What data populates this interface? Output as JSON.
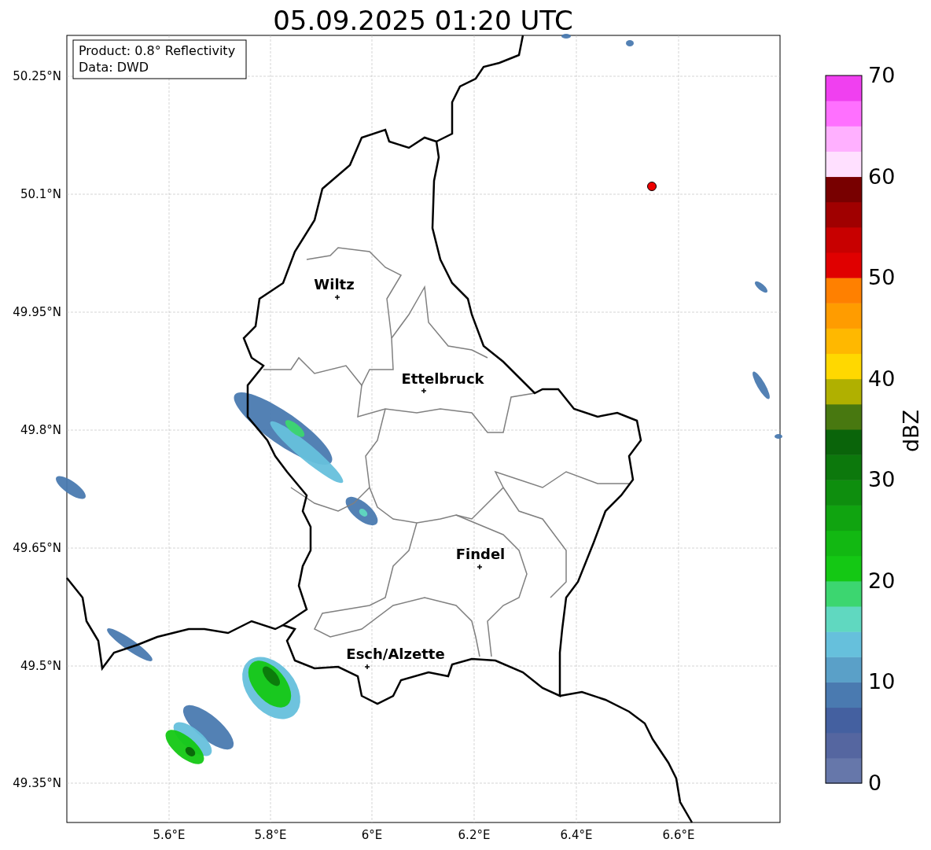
{
  "title": "05.09.2025 01:20 UTC",
  "info_box": {
    "lines": [
      "Product: 0.8° Reflectivity",
      "Data: DWD"
    ]
  },
  "map": {
    "y_ticks": [
      "50.25°N",
      "50.1°N",
      "49.95°N",
      "49.8°N",
      "49.65°N",
      "49.5°N",
      "49.35°N"
    ],
    "x_ticks": [
      "5.6°E",
      "5.8°E",
      "6°E",
      "6.2°E",
      "6.4°E",
      "6.6°E"
    ],
    "places": [
      {
        "name": "Wiltz"
      },
      {
        "name": "Ettelbruck"
      },
      {
        "name": "Findel"
      },
      {
        "name": "Esch/Alzette"
      }
    ]
  },
  "colorbar": {
    "label": "dBZ",
    "ticks": [
      "70",
      "60",
      "50",
      "40",
      "30",
      "20",
      "10",
      "0"
    ]
  }
}
